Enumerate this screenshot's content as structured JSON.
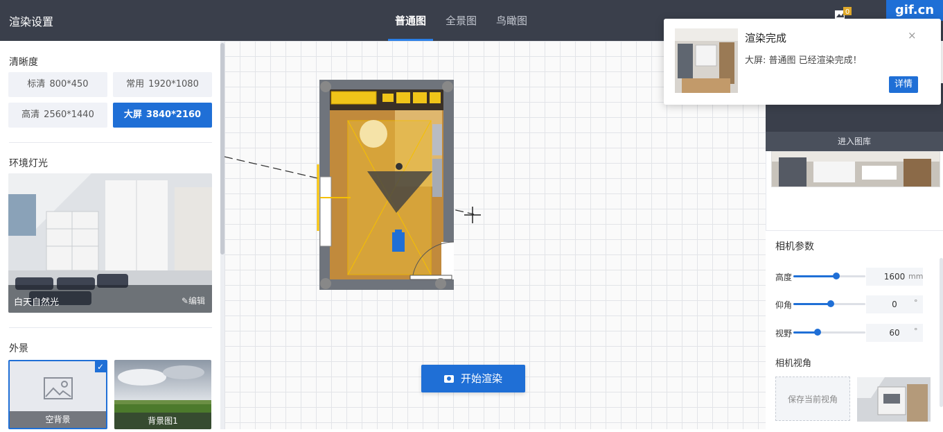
{
  "header": {
    "title": "渲染设置",
    "tabs": [
      {
        "label": "普通图",
        "active": true
      },
      {
        "label": "全景图",
        "active": false
      },
      {
        "label": "鸟瞰图",
        "active": false
      }
    ],
    "image_count": "0",
    "watermark": "gif.cn"
  },
  "sidebar": {
    "resolution_title": "清晰度",
    "resolutions": [
      {
        "name": "标清",
        "size": "800*450",
        "active": false
      },
      {
        "name": "常用",
        "size": "1920*1080",
        "active": false
      },
      {
        "name": "高清",
        "size": "2560*1440",
        "active": false
      },
      {
        "name": "大屏",
        "size": "3840*2160",
        "active": true
      }
    ],
    "lighting_title": "环境灯光",
    "lighting": {
      "name": "白天自然光",
      "edit_label": "编辑"
    },
    "exterior_title": "外景",
    "exteriors": [
      {
        "name": "空背景",
        "selected": true
      },
      {
        "name": "背景图1",
        "selected": false
      }
    ]
  },
  "canvas": {
    "start_render_label": "开始渲染"
  },
  "gallery": {
    "enter_label": "进入图库"
  },
  "camera": {
    "title": "相机参数",
    "params": [
      {
        "label": "高度",
        "value": "1600",
        "unit": "mm",
        "level": 0.6
      },
      {
        "label": "仰角",
        "value": "0",
        "unit": "°",
        "level": 0.5
      },
      {
        "label": "视野",
        "value": "60",
        "unit": "°",
        "level": 0.33
      }
    ],
    "view_title": "相机视角",
    "save_view_label": "保存当前视角"
  },
  "toast": {
    "title": "渲染完成",
    "message": "大屏: 普通图 已经渲染完成！",
    "close": "×",
    "details_label": "详情"
  },
  "colors": {
    "accent": "#1f6fd6",
    "header": "#3a3f4b"
  }
}
